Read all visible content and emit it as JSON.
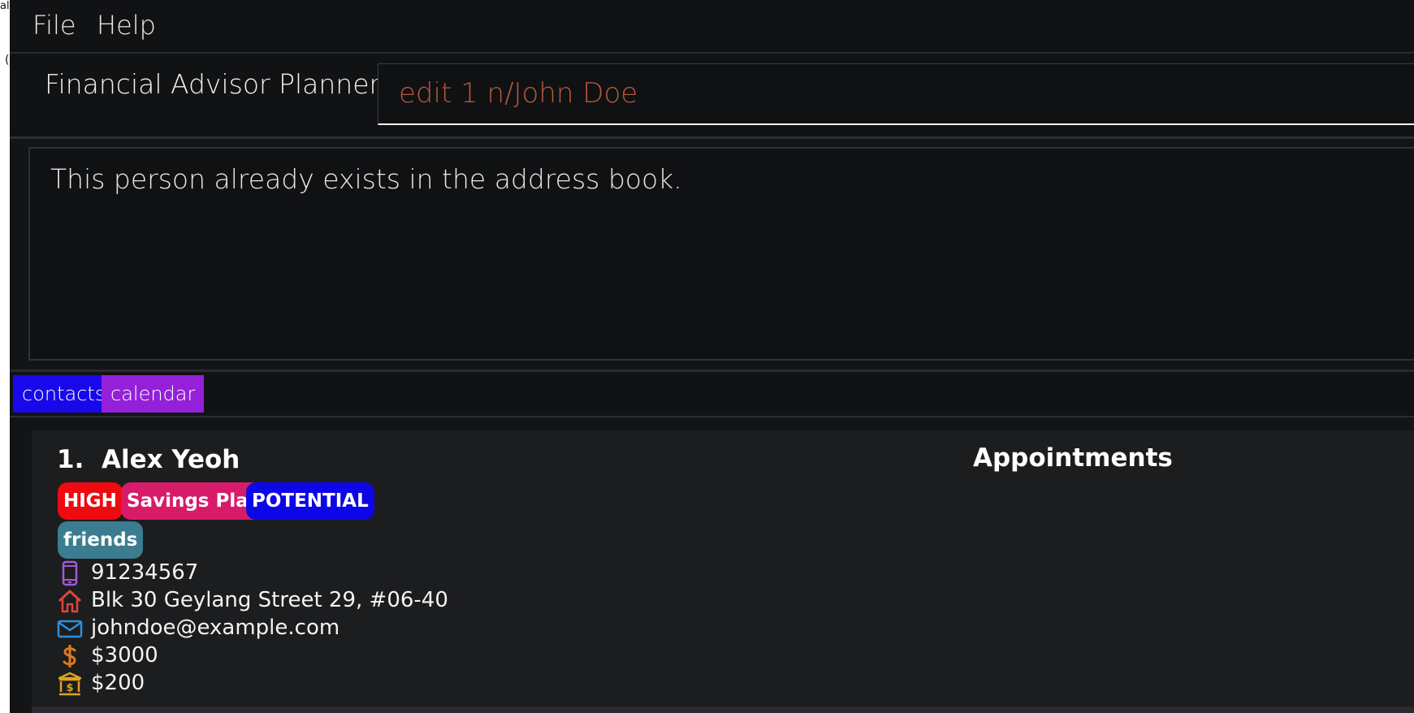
{
  "menu": {
    "file": "File",
    "help": "Help"
  },
  "app": {
    "title": "Financial Advisor Planner"
  },
  "command": {
    "value": "edit 1 n/John Doe"
  },
  "result": {
    "message": "This person already exists in the address book."
  },
  "tabs": [
    {
      "label": "contacts"
    },
    {
      "label": "calendar"
    }
  ],
  "person": {
    "index": "1.",
    "name": "Alex Yeoh",
    "tags": [
      "HIGH",
      "Savings Plan",
      "POTENTIAL",
      "friends"
    ],
    "phone": "91234567",
    "address": "Blk 30 Geylang Street 29, #06-40",
    "email": "johndoe@example.com",
    "income": "$3000",
    "monthly_savings": "$200"
  },
  "appointments": {
    "heading": "Appointments"
  },
  "colors": {
    "high_tag": "#ee0a10",
    "plan_tag": "#d81b69",
    "potential_tag": "#0d06e6",
    "friends_tag": "#3b7c91",
    "contacts_tab": "#1808ea",
    "calendar_tab": "#9421d9",
    "command_text": "#b5583c"
  },
  "icons": [
    "phone-icon",
    "home-icon",
    "email-icon",
    "dollar-icon",
    "bank-icon"
  ]
}
